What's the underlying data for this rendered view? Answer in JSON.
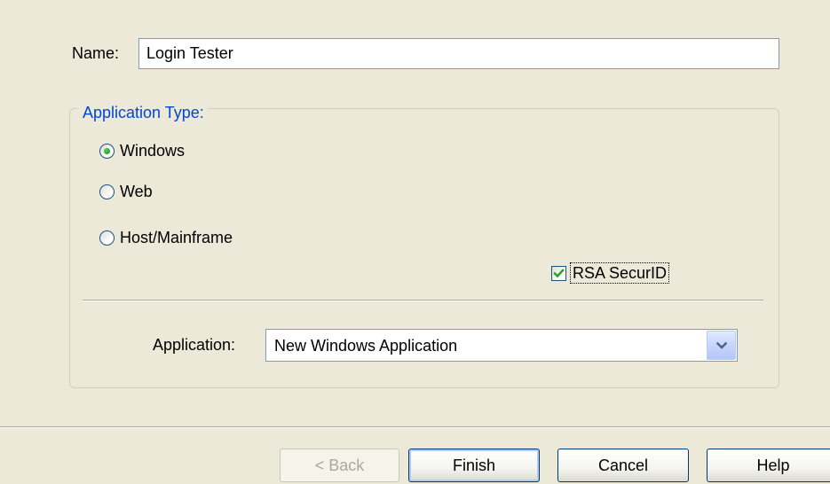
{
  "form": {
    "name_label": "Name:",
    "name_value": "Login Tester"
  },
  "application_type": {
    "legend": "Application Type:",
    "options": [
      {
        "label": "Windows",
        "selected": true
      },
      {
        "label": "Web",
        "selected": false
      },
      {
        "label": "Host/Mainframe",
        "selected": false
      }
    ],
    "rsa": {
      "label": "RSA SecurID",
      "checked": true
    },
    "application_label": "Application:",
    "application_value": "New Windows Application"
  },
  "buttons": {
    "back": "< Back",
    "finish": "Finish",
    "cancel": "Cancel",
    "help": "Help"
  },
  "colors": {
    "background": "#ECE9D8",
    "legend_text": "#0046D5",
    "radio_dot": "#21A121",
    "check_mark": "#21A121",
    "disabled_text": "#ACA899"
  },
  "icons": {
    "dropdown": "chevron-down-icon",
    "checkbox": "check-icon"
  }
}
